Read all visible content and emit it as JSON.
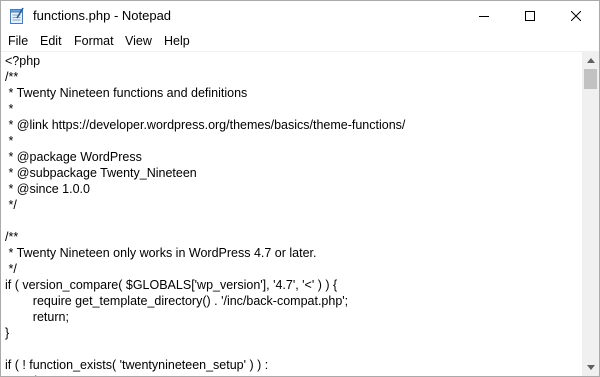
{
  "window": {
    "title": "functions.php - Notepad"
  },
  "menu": {
    "file": "File",
    "edit": "Edit",
    "format": "Format",
    "view": "View",
    "help": "Help"
  },
  "editor": {
    "lines": [
      "<?php",
      "/**",
      " * Twenty Nineteen functions and definitions",
      " *",
      " * @link https://developer.wordpress.org/themes/basics/theme-functions/",
      " *",
      " * @package WordPress",
      " * @subpackage Twenty_Nineteen",
      " * @since 1.0.0",
      " */",
      "",
      "/**",
      " * Twenty Nineteen only works in WordPress 4.7 or later.",
      " */",
      "if ( version_compare( $GLOBALS['wp_version'], '4.7', '<' ) ) {",
      "\t\trequire get_template_directory() . '/inc/back-compat.php';",
      "\t\treturn;",
      "}",
      "",
      "if ( ! function_exists( 'twentynineteen_setup' ) ) :",
      "\t\t/**"
    ]
  },
  "icons": {
    "app": "notepad-icon",
    "minimize": "minimize-icon",
    "maximize": "maximize-icon",
    "close": "close-icon",
    "scroll_up": "chevron-up-icon",
    "scroll_down": "chevron-down-icon"
  },
  "colors": {
    "scrollbar_track": "#f0f0f0",
    "scrollbar_thumb": "#c2c2c2",
    "window_border": "#aaaaaa"
  }
}
